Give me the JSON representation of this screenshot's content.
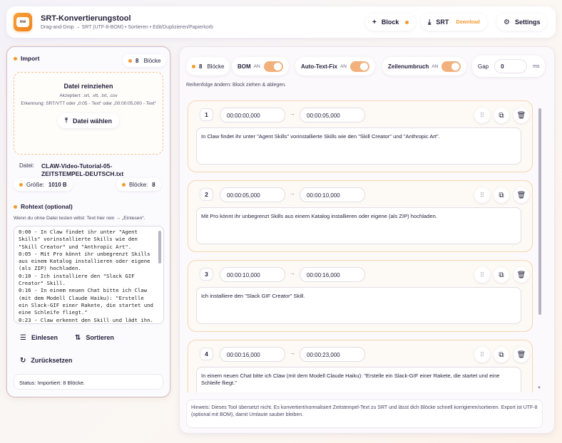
{
  "header": {
    "logo_text": "me",
    "title": "SRT-Konvertierungstool",
    "subtitle": "Drag-and-Drop → SRT (UTF-8-BOM) • Sortieren • Edit/Duplizieren/Papierkorb",
    "block_label": "Block",
    "srt_label": "SRT",
    "download_label": "Download",
    "settings_label": "Settings"
  },
  "import": {
    "title": "Import",
    "count": "8",
    "count_label": "Blöcke",
    "drop_title": "Datei reinziehen",
    "drop_accepted": "Akzeptiert: .srt, .vtt, .txt, .csv",
    "drop_detect": "Erkennung: SRT/VTT oder „0:05 - Text“ oder „00:00:05,000 - Text“",
    "choose_label": "Datei wählen",
    "file_label": "Datei:",
    "file_name": "CLAW-Video-Tutorial-05-ZEITSTEMPEL-DEUTSCH.txt",
    "size_label": "Größe:",
    "size_value": "1010 B",
    "blocks_label": "Blöcke:",
    "blocks_value": "8"
  },
  "rawtext": {
    "title": "Rohtext (optional)",
    "hint": "Wenn du ohne Datei testen willst: Text hier rein → „Einlesen“.",
    "content": "0:00 - In Claw findet ihr unter \"Agent Skills\" vorinstallierte Skills wie den \"Skill Creator\" und \"Anthropic Art\".\n0:05 - Mit Pro könnt ihr unbegrenzt Skills aus einem Katalog installieren oder eigene (als ZIP) hochladen.\n0:10 - Ich installiere den \"Slack GIF Creator\" Skill.\n0:16 - In einem neuen Chat bitte ich Claw (mit dem Modell Claude Haiku): \"Erstelle ein Slack-GIF einer Rakete, die startet und eine Schleife fliegt.\"\n0:23 - Claw erkennt den Skill und lädt ihn.",
    "read_label": "Einlesen",
    "sort_label": "Sortieren",
    "reset_label": "Zurücksetzen",
    "status": "Status: Importiert: 8 Blöcke."
  },
  "toolbar": {
    "count": "8",
    "count_label": "Blöcke",
    "bom_label": "BOM",
    "bom_state": "AN",
    "autofix_label": "Auto-Text-Fix",
    "autofix_state": "AN",
    "wrap_label": "Zeilenumbruch",
    "wrap_state": "AN",
    "gap_label": "Gap",
    "gap_value": "0",
    "gap_unit": "ms",
    "reorder_hint": "Reihenfolge ändern: Block ziehen & ablegen."
  },
  "blocks": [
    {
      "num": "1",
      "start": "00:00:00,000",
      "end": "00:00:05,000",
      "text": "In Claw findet ihr unter \"Agent Skills\" vorinstallierte Skills wie den \"Skill Creator\" und \"Anthropic Art\"."
    },
    {
      "num": "2",
      "start": "00:00:05,000",
      "end": "00:00:10,000",
      "text": "Mit Pro könnt ihr unbegrenzt Skills aus einem Katalog installieren oder eigene (als ZIP) hochladen."
    },
    {
      "num": "3",
      "start": "00:00:10,000",
      "end": "00:00:16,000",
      "text": "Ich installiere den \"Slack GIF Creator\" Skill."
    },
    {
      "num": "4",
      "start": "00:00:16,000",
      "end": "00:00:23,000",
      "text": "In einem neuen Chat bitte ich Claw (mit dem Modell Claude Haiku): \"Erstelle ein Slack-GIF einer Rakete, die startet und eine Schleife fliegt.\""
    }
  ],
  "footer_hint": "Hinweis: Dieses Tool übersetzt nicht. Es konvertiert/normalisiert Zeitstempel-Text zu SRT und lässt dich Blöcke schnell korrigieren/sortieren. Export ist UTF-8 (optional mit BOM), damit Umlaute sauber bleiben.",
  "colors": {
    "accent": "#f39a2f",
    "toggle": "#f2b07c",
    "left_border": "#c9c2e6"
  },
  "icons": [
    "plus-icon",
    "download-icon",
    "gear-icon",
    "upload-icon",
    "list-icon",
    "sort-icon",
    "reset-icon",
    "grip-icon",
    "duplicate-icon",
    "trash-icon"
  ]
}
